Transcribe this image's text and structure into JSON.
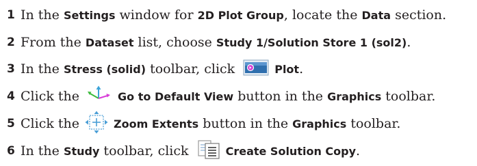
{
  "steps": [
    {
      "number": "1",
      "parts": {
        "t1": "In the ",
        "b1": "Settings",
        "t2": " window for ",
        "b2": "2D Plot Group",
        "t3": ", locate the ",
        "b3": "Data",
        "t4": " section."
      }
    },
    {
      "number": "2",
      "parts": {
        "t1": "From the ",
        "b1": "Dataset",
        "t2": " list, choose ",
        "b2": "Study 1/Solution Store 1 (sol2)",
        "t3": "."
      }
    },
    {
      "number": "3",
      "parts": {
        "t1": "In the ",
        "b1": "Stress (solid)",
        "t2": " toolbar, click ",
        "icon": "plot-icon",
        "b2": "Plot",
        "t3": "."
      }
    },
    {
      "number": "4",
      "parts": {
        "t1": "Click the ",
        "icon": "go-to-default-view-icon",
        "b1": "Go to Default View",
        "t2": " button in the ",
        "b2": "Graphics",
        "t3": " toolbar."
      }
    },
    {
      "number": "5",
      "parts": {
        "t1": "Click the ",
        "icon": "zoom-extents-icon",
        "b1": "Zoom Extents",
        "t2": " button in the ",
        "b2": "Graphics",
        "t3": " toolbar."
      }
    },
    {
      "number": "6",
      "parts": {
        "t1": "In the ",
        "b1": "Study",
        "t2": " toolbar, click ",
        "icon": "create-solution-copy-icon",
        "b2": "Create Solution Copy",
        "t3": "."
      }
    }
  ]
}
